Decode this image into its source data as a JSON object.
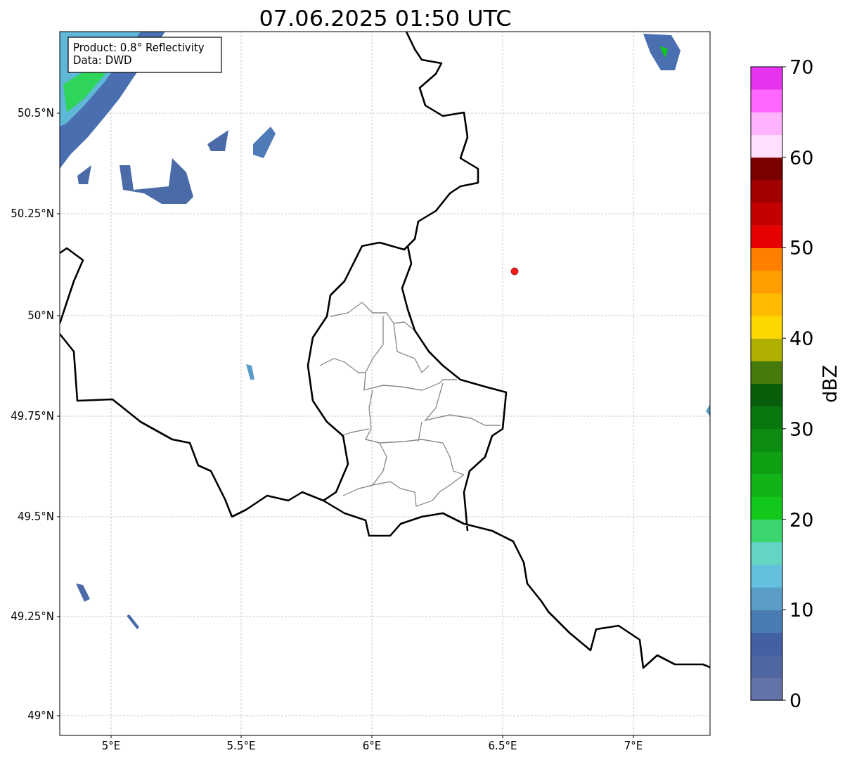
{
  "title": "07.06.2025 01:50 UTC",
  "info_box": [
    "Product: 0.8° Reflectivity",
    "Data: DWD"
  ],
  "map": {
    "lat_labels": [
      "50.5°N",
      "50.25°N",
      "50°N",
      "49.75°N",
      "49.5°N",
      "49.25°N",
      "49°N"
    ],
    "lon_labels": [
      "5°E",
      "5.5°E",
      "6°E",
      "6.5°E",
      "7°E"
    ]
  },
  "colorbar": {
    "label": "dBZ",
    "ticks": [
      "70",
      "60",
      "50",
      "40",
      "30",
      "20",
      "10",
      "0"
    ],
    "segments": [
      {
        "color": "#6474a8"
      },
      {
        "color": "#5066a0"
      },
      {
        "color": "#4260a2"
      },
      {
        "color": "#4a7cb4"
      },
      {
        "color": "#5a9ec8"
      },
      {
        "color": "#64c0dc"
      },
      {
        "color": "#62d6c2"
      },
      {
        "color": "#3cd66e"
      },
      {
        "color": "#12c81a"
      },
      {
        "color": "#10b416"
      },
      {
        "color": "#0ea012"
      },
      {
        "color": "#0c8c10"
      },
      {
        "color": "#0a760e"
      },
      {
        "color": "#085e0a"
      },
      {
        "color": "#467a0a"
      },
      {
        "color": "#b0b000"
      },
      {
        "color": "#ffd700"
      },
      {
        "color": "#ffbb00"
      },
      {
        "color": "#ff9e00"
      },
      {
        "color": "#ff7f00"
      },
      {
        "color": "#e60000"
      },
      {
        "color": "#c40000"
      },
      {
        "color": "#a00000"
      },
      {
        "color": "#7a0000"
      },
      {
        "color": "#ffe0ff"
      },
      {
        "color": "#ffb3ff"
      },
      {
        "color": "#ff66ff"
      },
      {
        "color": "#e833ee"
      }
    ]
  }
}
